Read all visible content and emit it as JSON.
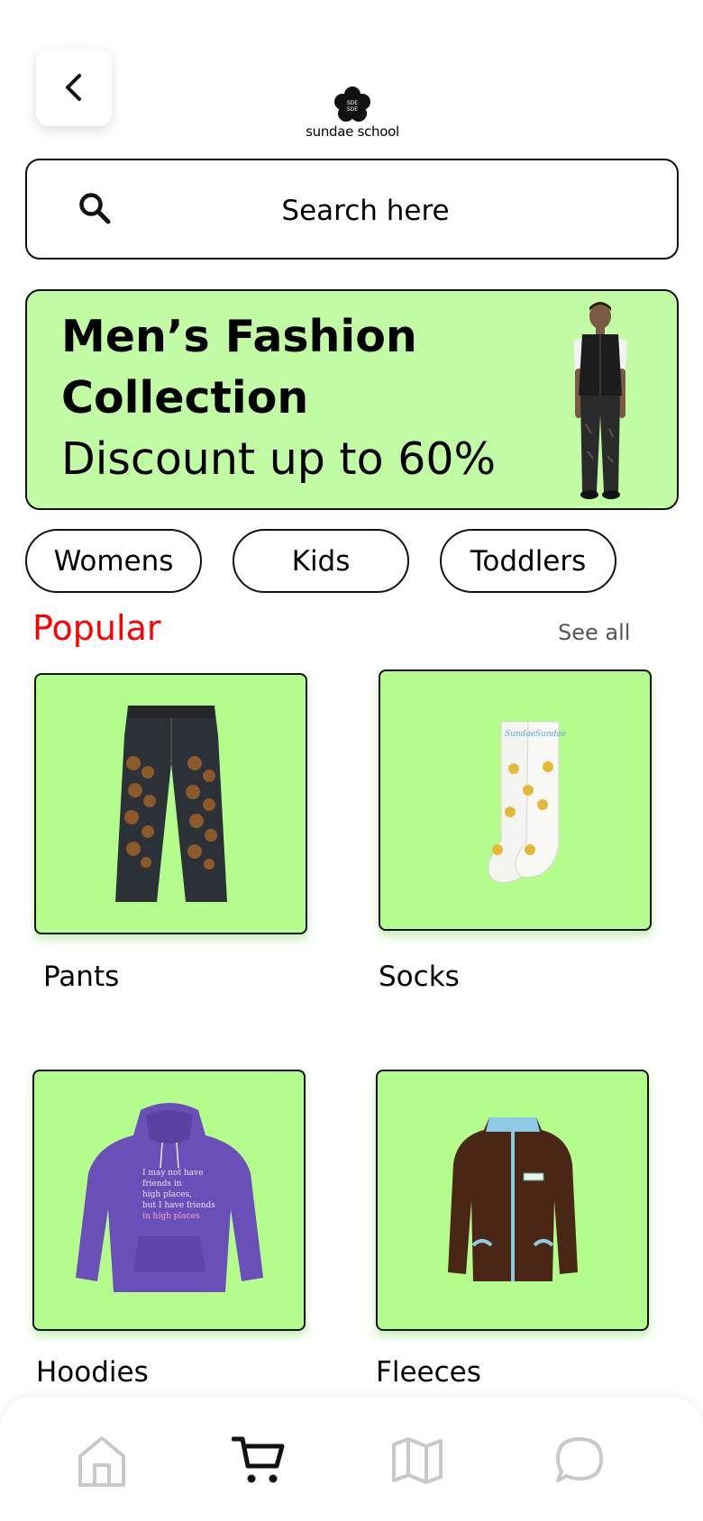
{
  "header": {
    "brand_name": "sundae school",
    "brand_mark_text": "SDE SDE"
  },
  "search": {
    "placeholder": "Search here"
  },
  "banner": {
    "line1": "Men’s Fashion",
    "line2": "Collection",
    "line3": "Discount up to 60%"
  },
  "categories": [
    "Womens",
    "Kids",
    "Toddlers"
  ],
  "popular": {
    "title": "Popular",
    "see_all": "See all",
    "items": [
      {
        "label": "Pants"
      },
      {
        "label": "Socks"
      },
      {
        "label": "Hoodies"
      },
      {
        "label": "Fleeces"
      }
    ]
  },
  "bottom_nav": {
    "items": [
      {
        "icon": "home-icon",
        "active": false
      },
      {
        "icon": "cart-icon",
        "active": true
      },
      {
        "icon": "map-icon",
        "active": false
      },
      {
        "icon": "chat-icon",
        "active": false
      }
    ]
  },
  "colors": {
    "banner_bg": "#c1fba4",
    "card_bg": "#b4fc8c",
    "accent_red": "#ff0000",
    "nav_inactive": "#c9c9c9"
  }
}
